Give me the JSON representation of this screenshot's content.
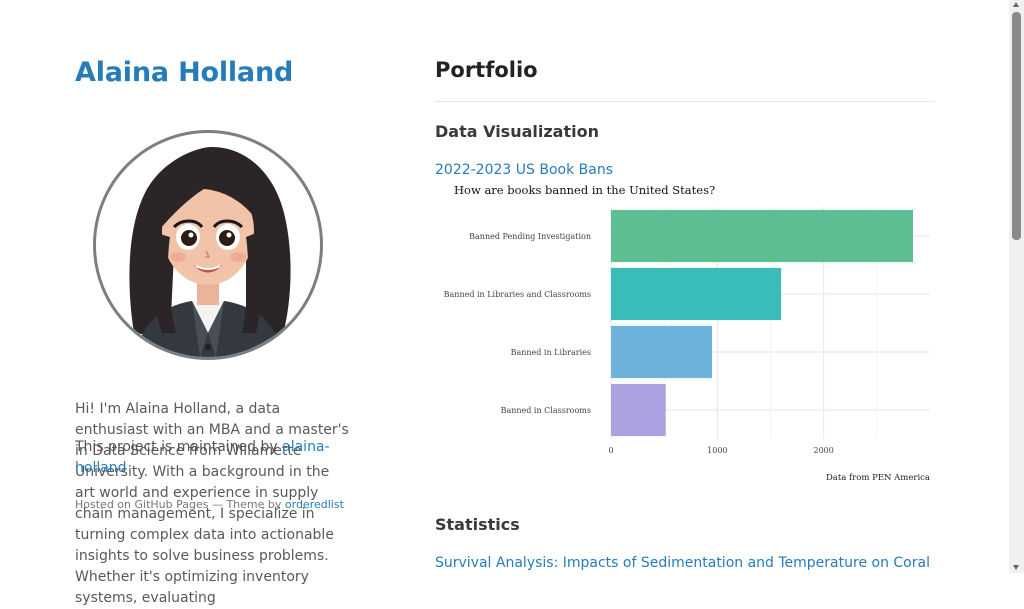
{
  "sidebar": {
    "title": "Alaina Holland",
    "bio": "Hi! I'm Alaina Holland, a data enthusiast with an MBA and a master's in Data Science from Willamette University. With a background in the art world and experience in supply chain management, I specialize in turning complex data into actionable insights to solve business problems. Whether it's optimizing inventory systems, evaluating",
    "maintained_prefix": "This project is maintained by ",
    "maintained_link": "alaina-holland",
    "hosted_prefix": "Hosted on GitHub Pages — Theme by ",
    "hosted_link": "orderedlist"
  },
  "main": {
    "title": "Portfolio",
    "sections": [
      {
        "title": "Data Visualization",
        "link": "2022-2023 US Book Bans"
      },
      {
        "title": "Statistics",
        "link": "Survival Analysis: Impacts of Sedimentation and Temperature on Coral"
      }
    ]
  },
  "chart_data": {
    "type": "bar",
    "orientation": "horizontal",
    "title": "How are books banned in the United States?",
    "caption": "Data from PEN America",
    "categories": [
      "Banned Pending Investigation",
      "Banned in Libraries and Classrooms",
      "Banned in Libraries",
      "Banned in Classrooms"
    ],
    "values": [
      2840,
      1600,
      950,
      515
    ],
    "colors": [
      "#5DBE92",
      "#3ABCBA",
      "#6CB2DB",
      "#AEA1E1"
    ],
    "xticks": [
      0,
      1000,
      2000
    ],
    "xlim": [
      0,
      3000
    ],
    "grid": true,
    "legend": "none"
  },
  "colors": {
    "accent": "#267CB9"
  }
}
